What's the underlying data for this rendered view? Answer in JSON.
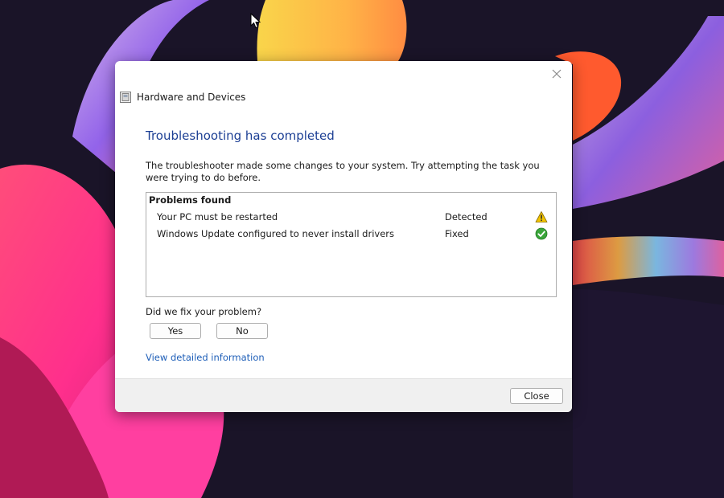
{
  "dialog": {
    "title": "Hardware and Devices",
    "heading": "Troubleshooting has completed",
    "description": "The troubleshooter made some changes to your system. Try attempting the task you were trying to do before.",
    "problems": {
      "header": "Problems found",
      "items": [
        {
          "name": "Your PC must be restarted",
          "status": "Detected",
          "icon": "warning-icon"
        },
        {
          "name": "Windows Update configured to never install drivers",
          "status": "Fixed",
          "icon": "check-icon"
        }
      ]
    },
    "question": "Did we fix your problem?",
    "yes_label": "Yes",
    "no_label": "No",
    "details_link": "View detailed information",
    "close_label": "Close"
  },
  "colors": {
    "heading": "#1c3f94",
    "link": "#1f5fb8",
    "warning": "#f2c400",
    "success": "#3aa53a"
  }
}
